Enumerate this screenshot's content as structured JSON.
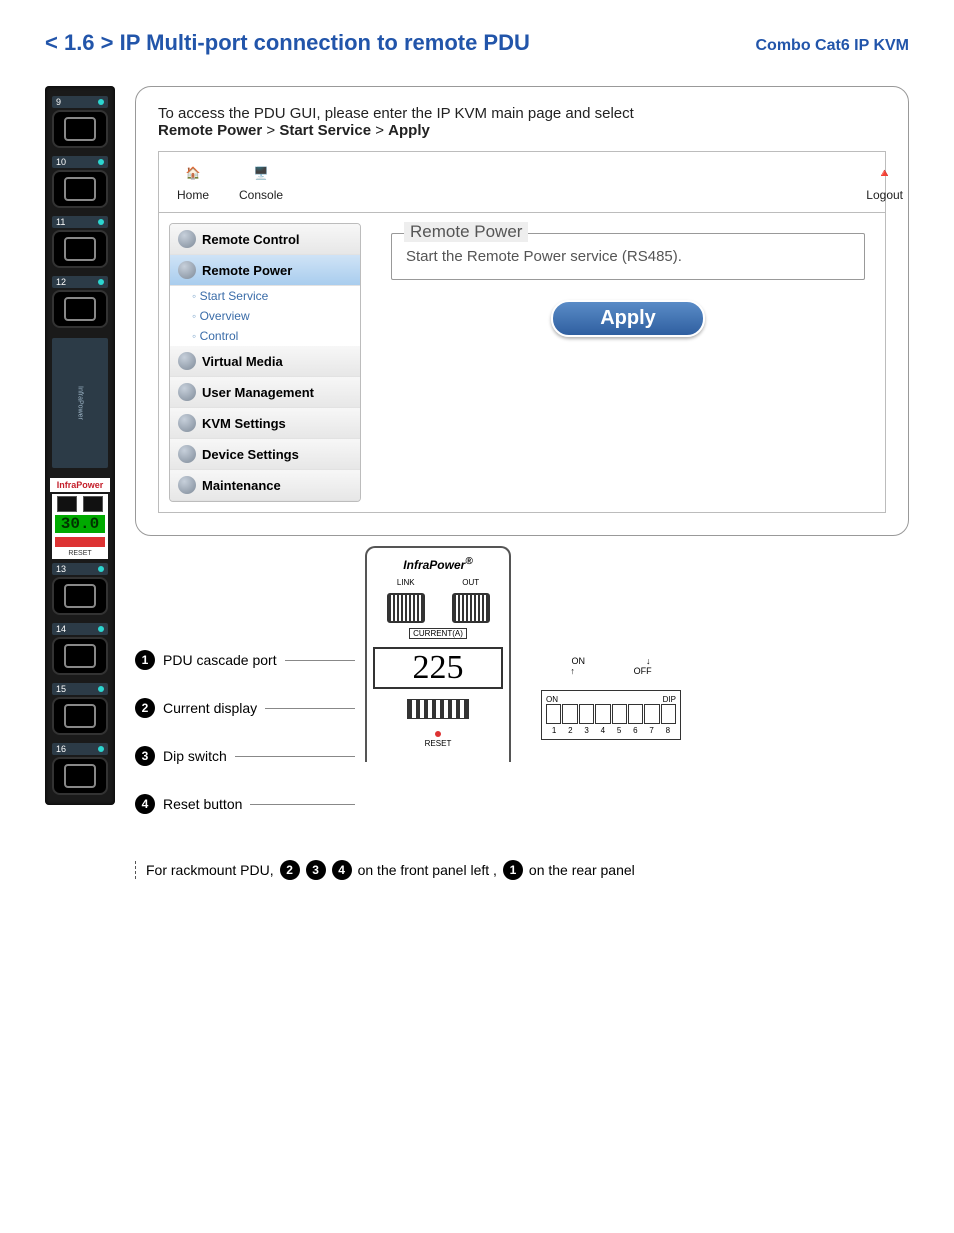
{
  "header": {
    "title": "< 1.6 > IP Multi-port connection to remote PDU",
    "subtitle": "Combo Cat6 IP KVM"
  },
  "pdu_strip": {
    "outlets_top": [
      "9",
      "10",
      "11",
      "12"
    ],
    "outlets_bottom": [
      "13",
      "14",
      "15",
      "16"
    ],
    "label_text": "InfraPower",
    "brand": "InfraPower",
    "current_reading": "30.0",
    "reset_label": "RESET"
  },
  "instruction": {
    "line1": "To access the PDU GUI, please enter the IP KVM main page and select",
    "path1": "Remote Power",
    "sep": ">",
    "path2": "Start Service",
    "path3": "Apply"
  },
  "gui": {
    "nav": {
      "home": "Home",
      "console": "Console",
      "logout": "Logout"
    },
    "sidebar": {
      "remote_control": "Remote Control",
      "remote_power": "Remote Power",
      "start_service": "Start Service",
      "overview": "Overview",
      "control": "Control",
      "virtual_media": "Virtual Media",
      "user_management": "User Management",
      "kvm_settings": "KVM Settings",
      "device_settings": "Device Settings",
      "maintenance": "Maintenance"
    },
    "panel": {
      "legend": "Remote Power",
      "desc": "Start the Remote Power service (RS485).",
      "apply": "Apply"
    }
  },
  "diagram": {
    "brand": "InfraPower",
    "link": "LINK",
    "out": "OUT",
    "current_label": "CURRENT(A)",
    "current_value": "225",
    "reset": "RESET",
    "items": {
      "1": "PDU cascade port",
      "2": "Current display",
      "3": "Dip switch",
      "4": "Reset button"
    },
    "switch": {
      "on": "ON",
      "off": "OFF",
      "dip": "DIP",
      "nums": [
        "1",
        "2",
        "3",
        "4",
        "5",
        "6",
        "7",
        "8"
      ]
    },
    "footer": {
      "prefix": "For rackmount PDU,",
      "mid": "on the front panel left ,",
      "suffix": "on the rear panel"
    }
  }
}
